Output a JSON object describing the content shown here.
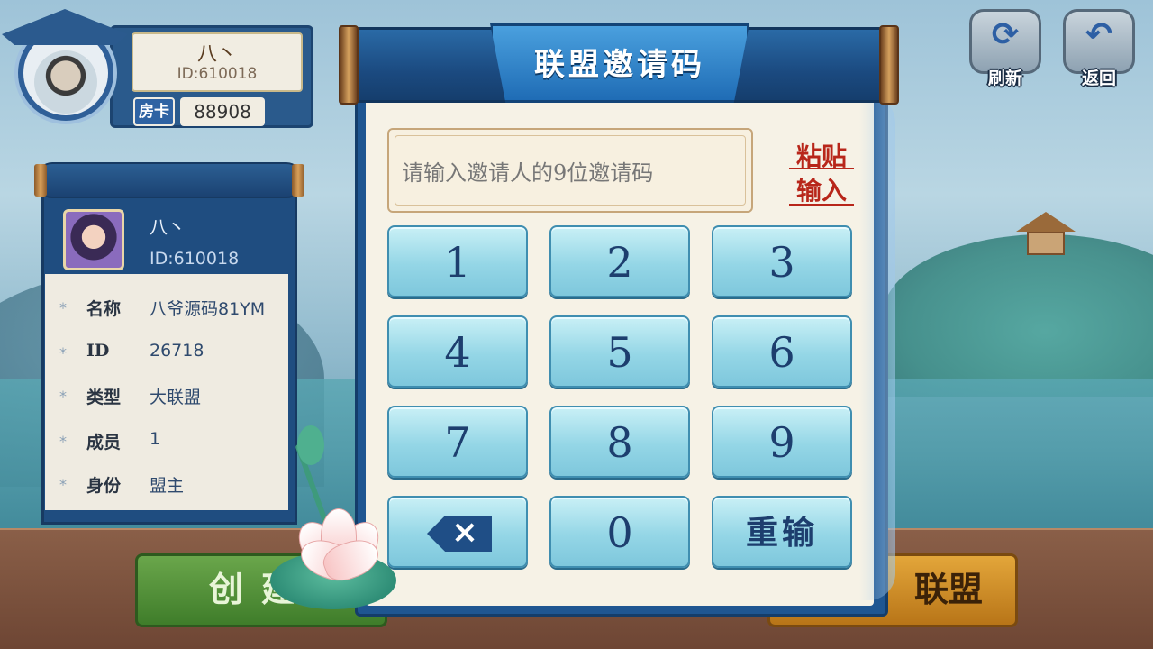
{
  "player": {
    "name": "八丶",
    "id_text": "ID:610018",
    "card_label": "房卡",
    "card_count": "88908"
  },
  "alliance": {
    "owner_name": "八丶",
    "owner_id_text": "ID:610018",
    "rows": [
      {
        "label": "名称",
        "value": "八爷源码81YM"
      },
      {
        "label": "ID",
        "value": "26718"
      },
      {
        "label": "类型",
        "value": "大联盟"
      },
      {
        "label": "成员",
        "value": "1"
      },
      {
        "label": "身份",
        "value": "盟主"
      }
    ]
  },
  "top_buttons": {
    "refresh_label": "刷新",
    "refresh_icon": "refresh-icon",
    "back_label": "返回",
    "back_icon": "back-arrow-icon"
  },
  "dialog": {
    "title": "联盟邀请码",
    "placeholder": "请输入邀请人的9位邀请码",
    "paste_line1": "粘贴",
    "paste_line2": "输入",
    "keys": [
      "1",
      "2",
      "3",
      "4",
      "5",
      "6",
      "7",
      "8",
      "9",
      "0"
    ],
    "reset_label": "重输",
    "backspace_icon": "backspace-icon"
  },
  "bottom": {
    "create_label": "创建",
    "join_label": "联盟"
  },
  "colors": {
    "accent_blue": "#1f5691",
    "key_teal": "#94d6e6",
    "paste_red": "#b8261a",
    "create_green": "#4f8f35",
    "join_orange": "#d69430"
  }
}
